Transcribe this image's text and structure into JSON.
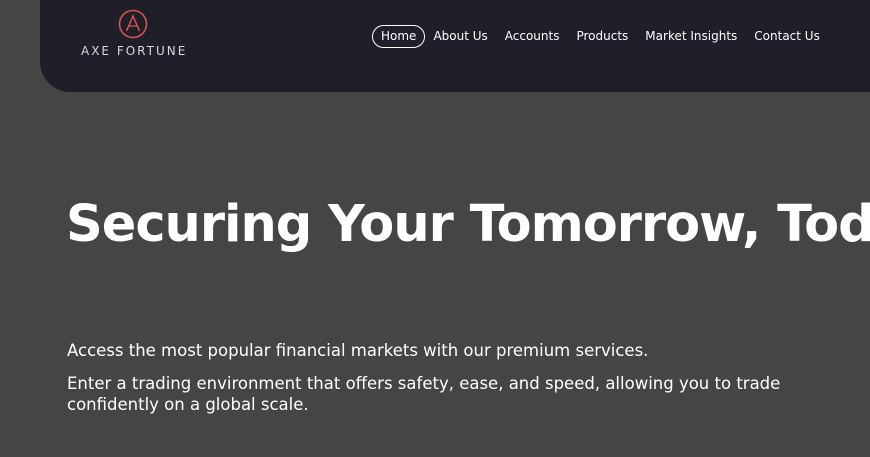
{
  "brand": {
    "name": "AXE FORTUNE",
    "logo_icon": "letter-a-circle-icon",
    "accent_color": "#d9534f"
  },
  "nav": {
    "items": [
      {
        "label": "Home",
        "active": true
      },
      {
        "label": "About Us",
        "active": false
      },
      {
        "label": "Accounts",
        "active": false
      },
      {
        "label": "Products",
        "active": false
      },
      {
        "label": "Market Insights",
        "active": false
      },
      {
        "label": "Contact Us",
        "active": false
      }
    ]
  },
  "hero": {
    "title": "Securing Your Tomorrow, Today",
    "subtitle": "Access the most popular financial markets with our premium services.",
    "description_line1": "Enter a trading environment that offers safety, ease, and speed, allowing you to trade",
    "description_line2": "confidently on a global scale."
  },
  "colors": {
    "page_background": "#454545",
    "header_background": "#1f1f29",
    "text": "#ffffff"
  }
}
